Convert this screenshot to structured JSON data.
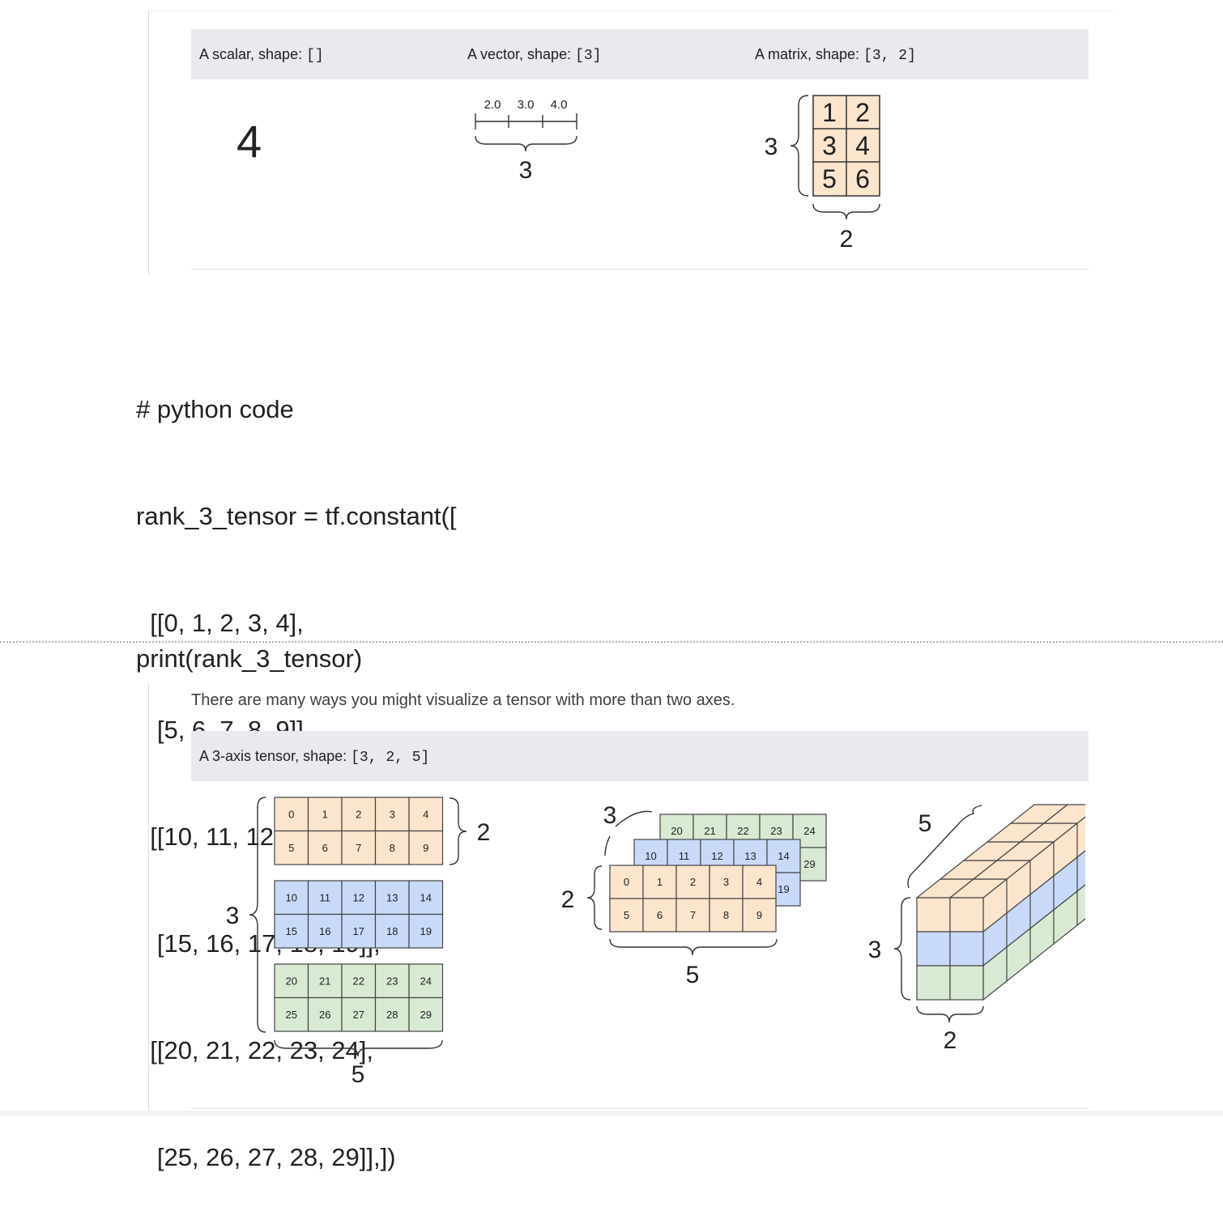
{
  "colors": {
    "orange": "#fce5cd",
    "blue": "#c9daf8",
    "green": "#d9ead3",
    "header_bg": "#e8eaed",
    "rule": "#dadce0"
  },
  "table1": {
    "headers": [
      "A scalar, shape: ",
      "A vector, shape: ",
      "A matrix, shape: "
    ],
    "shapes": [
      "[]",
      "[3]",
      "[3, 2]"
    ],
    "scalar": "4",
    "vector": {
      "values": [
        "2.0",
        "3.0",
        "4.0"
      ],
      "size": "3"
    },
    "matrix": {
      "cells": [
        "1",
        "2",
        "3",
        "4",
        "5",
        "6"
      ],
      "rows": "3",
      "cols": "2"
    }
  },
  "code_lines": [
    "# python code",
    "rank_3_tensor = tf.constant([",
    "  [[0, 1, 2, 3, 4],",
    "   [5, 6, 7, 8, 9]],",
    "  [[10, 11, 12, 13, 14],",
    "   [15, 16, 17, 18, 19]],",
    "  [[20, 21, 22, 23, 24],",
    "   [25, 26, 27, 28, 29]],])"
  ],
  "print_line": "print(rank_3_tensor)",
  "description": "There are many ways you might visualize a tensor with more than two axes.",
  "table2": {
    "header": "A 3-axis tensor, shape: ",
    "shape": "[3, 2, 5]",
    "stack": {
      "slices": [
        [
          [
            "0",
            "1",
            "2",
            "3",
            "4"
          ],
          [
            "5",
            "6",
            "7",
            "8",
            "9"
          ]
        ],
        [
          [
            "10",
            "11",
            "12",
            "13",
            "14"
          ],
          [
            "15",
            "16",
            "17",
            "18",
            "19"
          ]
        ],
        [
          [
            "20",
            "21",
            "22",
            "23",
            "24"
          ],
          [
            "25",
            "26",
            "27",
            "28",
            "29"
          ]
        ]
      ],
      "rows_label": "2",
      "depth_label": "3",
      "cols_label": "5"
    },
    "layered": {
      "back": [
        "20",
        "21",
        "22",
        "23",
        "24"
      ],
      "back_extra": "29",
      "mid": [
        "10",
        "11",
        "12",
        "13",
        "14"
      ],
      "mid_extra": "19",
      "front": [
        [
          "0",
          "1",
          "2",
          "3",
          "4"
        ],
        [
          "5",
          "6",
          "7",
          "8",
          "9"
        ]
      ],
      "depth_label": "3",
      "rows_label": "2",
      "cols_label": "5"
    },
    "cube": {
      "depth_label": "5",
      "height_label": "3",
      "width_label": "2"
    }
  }
}
